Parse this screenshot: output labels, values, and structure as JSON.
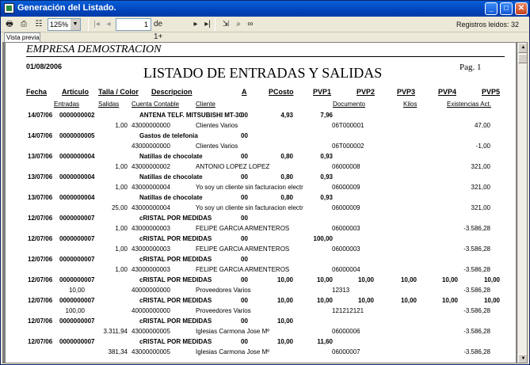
{
  "window": {
    "title": "Generación del Listado."
  },
  "toolbar": {
    "zoom": "125%",
    "page": "1",
    "page_of": "de 1+",
    "registros": "Registros leidos: 32"
  },
  "tab": {
    "label": "Vista previa"
  },
  "report": {
    "company": "EMPRESA DEMOSTRACION",
    "date": "01/08/2006",
    "title": "LISTADO DE ENTRADAS Y SALIDAS",
    "page": "Pag.  1",
    "headers1": {
      "fecha": "Fecha",
      "articulo": "Articulo",
      "talla": "Talla / Color",
      "descripcion": "Descripcion",
      "a": "A",
      "pcosto": "PCosto",
      "pvp1": "PVP1",
      "pvp2": "PVP2",
      "pvp3": "PVP3",
      "pvp4": "PVP4",
      "pvp5": "PVP5"
    },
    "headers2": {
      "entradas": "Entradas",
      "salidas": "Salidas",
      "cuenta": "Cuenta Contable",
      "cliente": "Cliente",
      "documento": "Documento",
      "kilos": "Kilos",
      "existencias": "Existencias Act."
    },
    "rows": [
      {
        "fecha": "14/07/06",
        "art": "0000000002",
        "desc": "ANTENA TELF. MITSUBISHI MT-30",
        "a": "00",
        "pcosto": "4,93",
        "pvp1": "7,96",
        "pvp2": "",
        "pvp3": "",
        "pvp4": "",
        "pvp5": "",
        "ent": "",
        "sal": "1,00",
        "cuenta": "43000000000",
        "cliente": "Clientes Varios",
        "doc": "06T000001",
        "kilos": "",
        "exist": "47,00"
      },
      {
        "fecha": "14/07/06",
        "art": "0000000005",
        "desc": "Gastos de telefonia",
        "a": "00",
        "pcosto": "",
        "pvp1": "",
        "pvp2": "",
        "pvp3": "",
        "pvp4": "",
        "pvp5": "",
        "ent": "",
        "sal": "",
        "cuenta": "43000000000",
        "cliente": "Clientes Varios",
        "doc": "06T000002",
        "kilos": "",
        "exist": "-1,00"
      },
      {
        "fecha": "13/07/06",
        "art": "0000000004",
        "desc": "Natillas de chocolate",
        "a": "00",
        "pcosto": "0,80",
        "pvp1": "0,93",
        "pvp2": "",
        "pvp3": "",
        "pvp4": "",
        "pvp5": "",
        "ent": "",
        "sal": "1,00",
        "cuenta": "43000000002",
        "cliente": "ANTONIO LOPEZ LOPEZ",
        "doc": "06000008",
        "kilos": "",
        "exist": "321,00"
      },
      {
        "fecha": "13/07/06",
        "art": "0000000004",
        "desc": "Natillas de chocolate",
        "a": "00",
        "pcosto": "0,80",
        "pvp1": "0,93",
        "pvp2": "",
        "pvp3": "",
        "pvp4": "",
        "pvp5": "",
        "ent": "",
        "sal": "1,00",
        "cuenta": "43000000004",
        "cliente": "Yo soy un cliente sin facturacion electr",
        "doc": "06000009",
        "kilos": "",
        "exist": "321,00"
      },
      {
        "fecha": "13/07/06",
        "art": "0000000004",
        "desc": "Natillas de chocolate",
        "a": "00",
        "pcosto": "0,80",
        "pvp1": "0,93",
        "pvp2": "",
        "pvp3": "",
        "pvp4": "",
        "pvp5": "",
        "ent": "",
        "sal": "25,00",
        "cuenta": "43000000004",
        "cliente": "Yo soy un cliente sin facturacion electr",
        "doc": "06000009",
        "kilos": "",
        "exist": "321,00"
      },
      {
        "fecha": "12/07/06",
        "art": "0000000007",
        "desc": "cRISTAL POR MEDIDAS",
        "a": "00",
        "pcosto": "",
        "pvp1": "",
        "pvp2": "",
        "pvp3": "",
        "pvp4": "",
        "pvp5": "",
        "ent": "",
        "sal": "1,00",
        "cuenta": "43000000003",
        "cliente": "FELIPE GARCIA ARMENTEROS",
        "doc": "06000003",
        "kilos": "",
        "exist": "-3.586,28"
      },
      {
        "fecha": "12/07/06",
        "art": "0000000007",
        "desc": "cRISTAL POR MEDIDAS",
        "a": "00",
        "pcosto": "",
        "pvp1": "100,00",
        "pvp2": "",
        "pvp3": "",
        "pvp4": "",
        "pvp5": "",
        "ent": "",
        "sal": "1,00",
        "cuenta": "43000000003",
        "cliente": "FELIPE GARCIA ARMENTEROS",
        "doc": "06000003",
        "kilos": "",
        "exist": "-3.586,28"
      },
      {
        "fecha": "12/07/06",
        "art": "0000000007",
        "desc": "cRISTAL POR MEDIDAS",
        "a": "00",
        "pcosto": "",
        "pvp1": "",
        "pvp2": "",
        "pvp3": "",
        "pvp4": "",
        "pvp5": "",
        "ent": "",
        "sal": "1,00",
        "cuenta": "43000000003",
        "cliente": "FELIPE GARCIA ARMENTEROS",
        "doc": "06000004",
        "kilos": "",
        "exist": "-3.586,28"
      },
      {
        "fecha": "12/07/06",
        "art": "0000000007",
        "desc": "cRISTAL POR MEDIDAS",
        "a": "00",
        "pcosto": "10,00",
        "pvp1": "10,00",
        "pvp2": "10,00",
        "pvp3": "10,00",
        "pvp4": "10,00",
        "pvp5": "10,00",
        "ent": "10,00",
        "sal": "",
        "cuenta": "40000000000",
        "cliente": "Proveedores Varios",
        "doc": "12313",
        "kilos": "",
        "exist": "-3.586,28"
      },
      {
        "fecha": "12/07/06",
        "art": "0000000007",
        "desc": "cRISTAL POR MEDIDAS",
        "a": "00",
        "pcosto": "10,00",
        "pvp1": "10,00",
        "pvp2": "10,00",
        "pvp3": "10,00",
        "pvp4": "10,00",
        "pvp5": "10,00",
        "ent": "100,00",
        "sal": "",
        "cuenta": "40000000000",
        "cliente": "Proveedores Varios",
        "doc": "121212121",
        "kilos": "",
        "exist": "-3.586,28"
      },
      {
        "fecha": "12/07/06",
        "art": "0000000007",
        "desc": "cRISTAL POR MEDIDAS",
        "a": "00",
        "pcosto": "10,00",
        "pvp1": "",
        "pvp2": "",
        "pvp3": "",
        "pvp4": "",
        "pvp5": "",
        "ent": "",
        "sal": "3.311,94",
        "cuenta": "43000000005",
        "cliente": "Iglesias Carmona Jose Mº",
        "doc": "06000006",
        "kilos": "",
        "exist": "-3.586,28"
      },
      {
        "fecha": "12/07/06",
        "art": "0000000007",
        "desc": "cRISTAL POR MEDIDAS",
        "a": "00",
        "pcosto": "10,00",
        "pvp1": "11,60",
        "pvp2": "",
        "pvp3": "",
        "pvp4": "",
        "pvp5": "",
        "ent": "",
        "sal": "381,34",
        "cuenta": "43000000005",
        "cliente": "Iglesias Carmona Jose Mº",
        "doc": "06000007",
        "kilos": "",
        "exist": "-3.586,28"
      }
    ]
  }
}
